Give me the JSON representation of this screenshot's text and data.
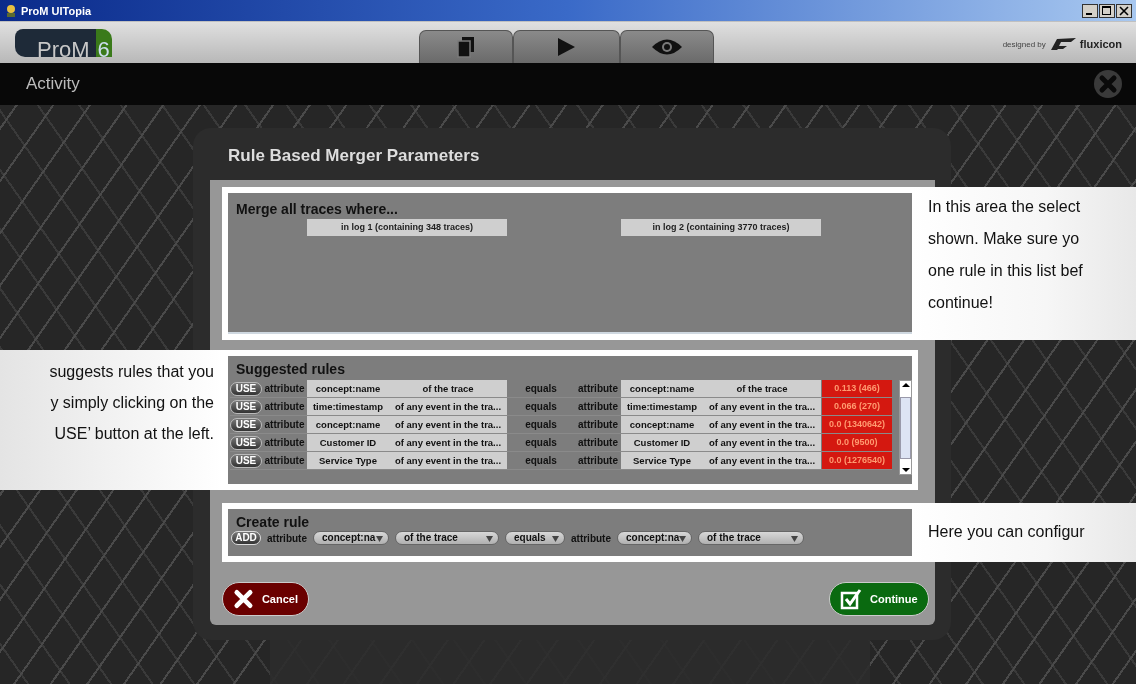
{
  "window": {
    "title": "ProM UITopia"
  },
  "header": {
    "logo_text": "ProM",
    "logo_version": "6",
    "toolbar": [
      {
        "kind": "documents"
      },
      {
        "kind": "play"
      },
      {
        "kind": "view"
      }
    ],
    "designed_by": "designed by",
    "brand": "fluxicon"
  },
  "activity_bar": {
    "title": "Activity"
  },
  "dialog": {
    "title": "Rule Based Merger Parameters",
    "merge": {
      "heading": "Merge all traces where...",
      "columns": [
        "in log 1 (containing 348 traces)",
        "in log 2 (containing 3770 traces)"
      ]
    },
    "suggested": {
      "heading": "Suggested rules",
      "rows": [
        {
          "button": "USE",
          "label1": "attribute",
          "attr1": "concept:name",
          "scope1": "of the trace",
          "operator": "equals",
          "label2": "attribute",
          "attr2": "concept:name",
          "scope2": "of the trace",
          "score": "0.113 (466)"
        },
        {
          "button": "USE",
          "label1": "attribute",
          "attr1": "time:timestamp",
          "scope1": "of any event in the tra...",
          "operator": "equals",
          "label2": "attribute",
          "attr2": "time:timestamp",
          "scope2": "of any event in the tra...",
          "score": "0.066 (270)"
        },
        {
          "button": "USE",
          "label1": "attribute",
          "attr1": "concept:name",
          "scope1": "of any event in the tra...",
          "operator": "equals",
          "label2": "attribute",
          "attr2": "concept:name",
          "scope2": "of any event in the tra...",
          "score": "0.0 (1340642)"
        },
        {
          "button": "USE",
          "label1": "attribute",
          "attr1": "Customer ID",
          "scope1": "of any event in the tra...",
          "operator": "equals",
          "label2": "attribute",
          "attr2": "Customer ID",
          "scope2": "of any event in the tra...",
          "score": "0.0 (9500)"
        },
        {
          "button": "USE",
          "label1": "attribute",
          "attr1": "Service Type",
          "scope1": "of any event in the tra...",
          "operator": "equals",
          "label2": "attribute",
          "attr2": "Service Type",
          "scope2": "of any event in the tra...",
          "score": "0.0 (1276540)"
        }
      ]
    },
    "create": {
      "heading": "Create rule",
      "button": "ADD",
      "label1": "attribute",
      "dropdowns1": [
        "concept:na",
        "of the trace",
        "equals"
      ],
      "label2": "attribute",
      "dropdowns2": [
        "concept:na",
        "of the trace"
      ]
    },
    "cancel": "Cancel",
    "continue": "Continue"
  },
  "callouts": [
    {
      "lines": [
        "In this area the select",
        "shown. Make sure yo",
        "one rule in this list bef",
        "continue!"
      ]
    },
    {
      "lines": [
        "suggests rules that you",
        "y simply clicking on the",
        "USE’ button at the left."
      ]
    },
    {
      "lines": [
        "Here you can configur"
      ]
    }
  ]
}
